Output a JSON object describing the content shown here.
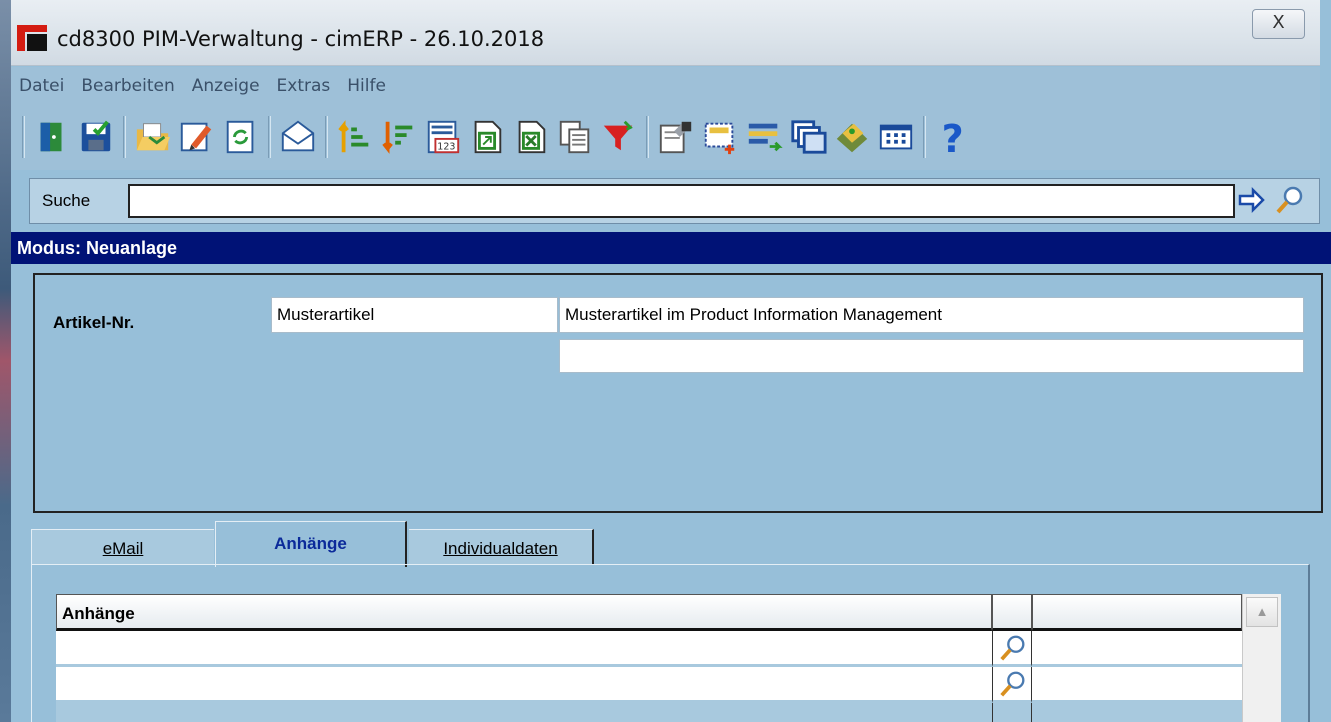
{
  "window": {
    "title": "cd8300 PIM-Verwaltung - cimERP - 26.10.2018",
    "close_label": "X"
  },
  "menu": [
    "Datei",
    "Bearbeiten",
    "Anzeige",
    "Extras",
    "Hilfe"
  ],
  "toolbar": {
    "groups": [
      [
        "exit-icon",
        "save-icon"
      ],
      [
        "open-folder-icon",
        "edit-pencil-icon",
        "refresh-icon"
      ],
      [
        "email-envelope-icon"
      ],
      [
        "sort-ascending-icon",
        "sort-descending-icon",
        "number-format-icon",
        "export-icon",
        "excel-export-icon",
        "copy-pages-icon",
        "filter-funnel-icon"
      ],
      [
        "properties-icon",
        "new-selection-icon",
        "transfer-icon",
        "windows-icon",
        "tag-icon",
        "calculator-icon"
      ],
      [
        "help-icon"
      ]
    ]
  },
  "search": {
    "label": "Suche",
    "value": "",
    "placeholder": ""
  },
  "mode": {
    "text": "Modus: Neuanlage"
  },
  "article": {
    "label": "Artikel-Nr.",
    "number": "Musterartikel",
    "description": "Musterartikel im Product Information Management",
    "description2": ""
  },
  "tabs": {
    "email_label": "eMail",
    "anhaenge_label": "Anhänge",
    "individual_label": "Individualdaten",
    "active": "Anhänge"
  },
  "attachments": {
    "column_header": "Anhänge",
    "rows": [
      {
        "name": "",
        "extra": ""
      },
      {
        "name": "",
        "extra": ""
      }
    ]
  },
  "colors": {
    "mode_bar": "#001276",
    "background": "#97bfd9",
    "active_tab_text": "#0b2a9a"
  }
}
